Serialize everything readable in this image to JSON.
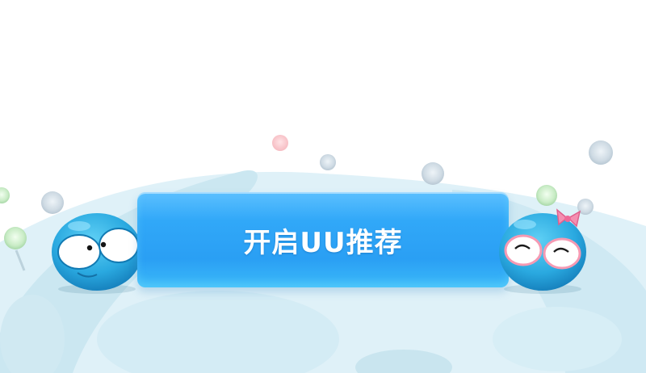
{
  "cta": {
    "label": "开启UU推荐",
    "color": "#31a8f8"
  },
  "mascots": {
    "left": {
      "icon": "blue-big-eyed-mascot-icon"
    },
    "right": {
      "icon": "blue-mascot-with-pink-bow-icon"
    }
  },
  "theme": {
    "planet_color": "#d6eef6",
    "accent_pink": "#f48fb1"
  }
}
